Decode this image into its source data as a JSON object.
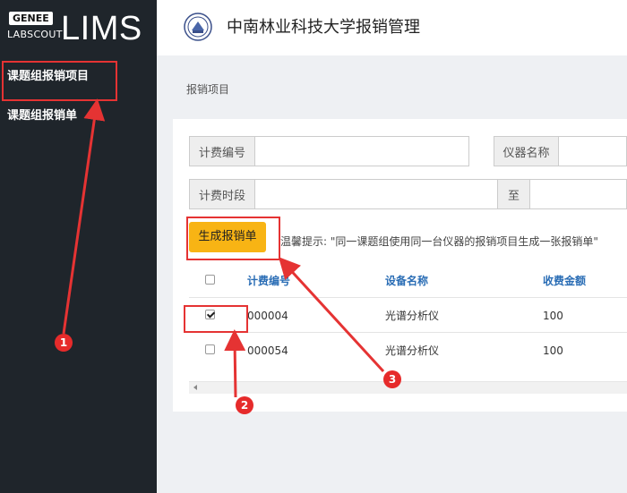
{
  "logo": {
    "genee": "GENEE",
    "labscout": "LABSCOUT",
    "lims": "LIMS"
  },
  "sidebar": {
    "items": [
      {
        "label": "课题组报销项目"
      },
      {
        "label": "课题组报销单"
      }
    ]
  },
  "header": {
    "title": "中南林业科技大学报销管理"
  },
  "breadcrumb": "报销项目",
  "filters": {
    "charge_no": "计费编号",
    "instrument_name": "仪器名称",
    "charge_period": "计费时段",
    "to": "至"
  },
  "actions": {
    "generate": "生成报销单"
  },
  "hint": "温馨提示: \"同一课题组使用同一台仪器的报销项目生成一张报销单\"",
  "table": {
    "headers": [
      "计费编号",
      "设备名称",
      "收费金额"
    ],
    "rows": [
      {
        "checked": true,
        "charge_no": "000004",
        "device": "光谱分析仪",
        "amount": "100"
      },
      {
        "checked": false,
        "charge_no": "000054",
        "device": "光谱分析仪",
        "amount": "100"
      }
    ]
  },
  "annotations": {
    "badges": [
      "1",
      "2",
      "3"
    ],
    "color": "#e53333"
  },
  "colors": {
    "sidebar": "#1f252b",
    "accent_button": "#f8b414",
    "header_link": "#2a6db5"
  }
}
